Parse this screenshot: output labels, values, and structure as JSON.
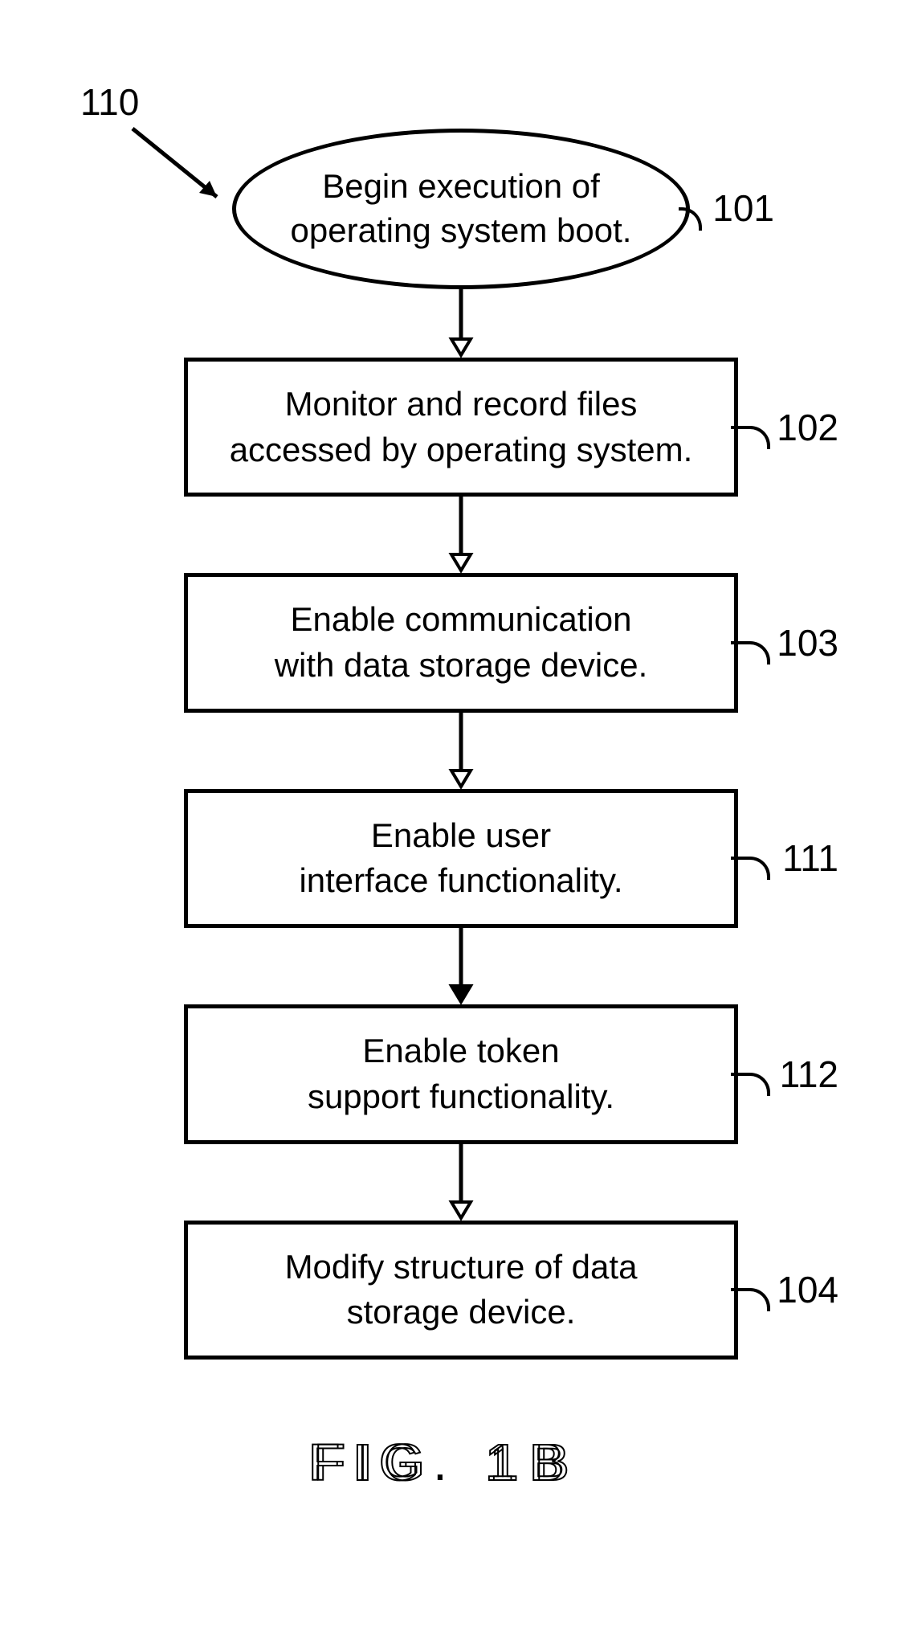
{
  "diagram_id_label": "110",
  "steps": [
    {
      "id": "101",
      "shape": "ellipse",
      "text_line1": "Begin execution of",
      "text_line2": "operating system boot."
    },
    {
      "id": "102",
      "shape": "rect",
      "text_line1": "Monitor and record files",
      "text_line2": "accessed by operating system."
    },
    {
      "id": "103",
      "shape": "rect",
      "text_line1": "Enable communication",
      "text_line2": "with data storage device."
    },
    {
      "id": "111",
      "shape": "rect",
      "text_line1": "Enable user",
      "text_line2": "interface functionality."
    },
    {
      "id": "112",
      "shape": "rect",
      "text_line1": "Enable token",
      "text_line2": "support functionality."
    },
    {
      "id": "104",
      "shape": "rect",
      "text_line1": "Modify structure of data",
      "text_line2": "storage device."
    }
  ],
  "figure_caption": "FIG. 1B"
}
